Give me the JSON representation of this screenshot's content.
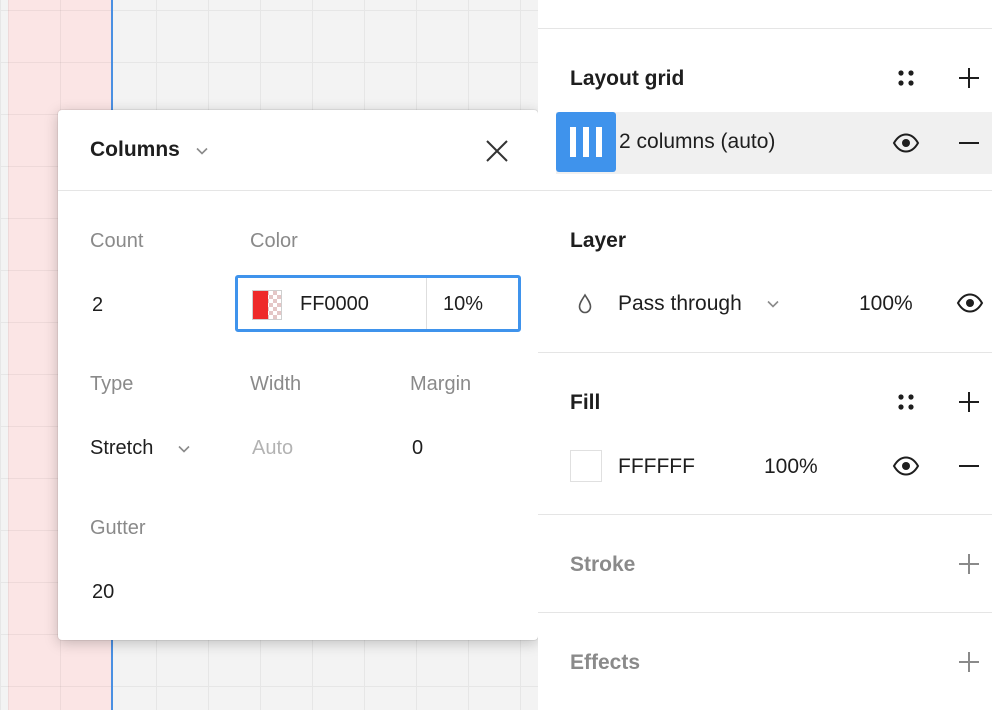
{
  "popover": {
    "title": "Columns",
    "count_label": "Count",
    "count_value": "2",
    "color_label": "Color",
    "color_hex": "FF0000",
    "color_opacity": "10%",
    "color_swatch": "#ee2a2a",
    "type_label": "Type",
    "type_value": "Stretch",
    "width_label": "Width",
    "width_placeholder": "Auto",
    "margin_label": "Margin",
    "margin_value": "0",
    "gutter_label": "Gutter",
    "gutter_value": "20"
  },
  "panel": {
    "layout_grid": {
      "title": "Layout grid",
      "item_label": "2 columns (auto)"
    },
    "layer": {
      "title": "Layer",
      "blend_mode": "Pass through",
      "opacity": "100%"
    },
    "fill": {
      "title": "Fill",
      "hex": "FFFFFF",
      "opacity": "100%",
      "swatch": "#ffffff"
    },
    "stroke": {
      "title": "Stroke"
    },
    "effects": {
      "title": "Effects"
    }
  },
  "colors": {
    "accent": "#3f93ec",
    "frame_edge": "#4a90e2",
    "frame_tint": "#fbe5e5"
  }
}
